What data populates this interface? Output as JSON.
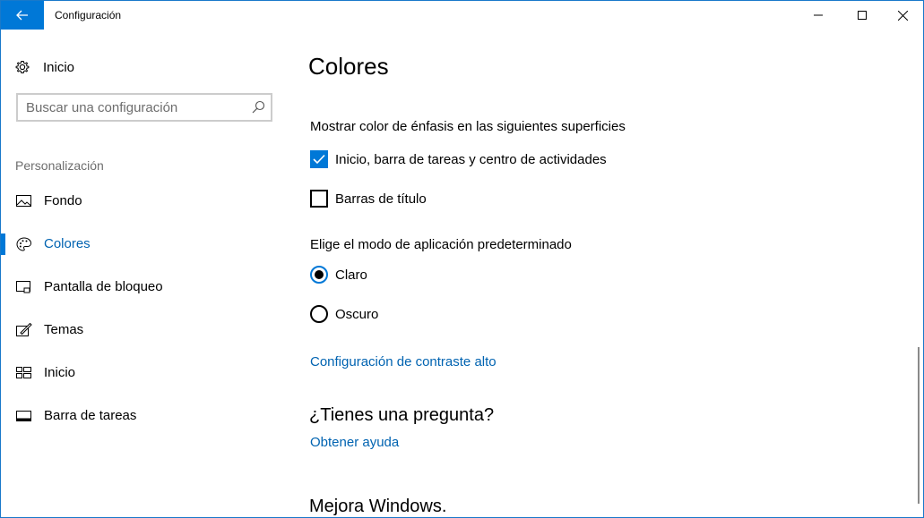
{
  "window": {
    "title": "Configuración"
  },
  "sidebar": {
    "home_label": "Inicio",
    "search_placeholder": "Buscar una configuración",
    "section_label": "Personalización",
    "items": [
      {
        "label": "Fondo",
        "icon": "picture-icon",
        "active": false
      },
      {
        "label": "Colores",
        "icon": "palette-icon",
        "active": true
      },
      {
        "label": "Pantalla de bloqueo",
        "icon": "lock-screen-icon",
        "active": false
      },
      {
        "label": "Temas",
        "icon": "themes-icon",
        "active": false
      },
      {
        "label": "Inicio",
        "icon": "start-tiles-icon",
        "active": false
      },
      {
        "label": "Barra de tareas",
        "icon": "taskbar-icon",
        "active": false
      }
    ]
  },
  "main": {
    "title": "Colores",
    "accent_heading": "Mostrar color de énfasis en las siguientes superficies",
    "checkboxes": [
      {
        "label": "Inicio, barra de tareas y centro de actividades",
        "checked": true
      },
      {
        "label": "Barras de título",
        "checked": false
      }
    ],
    "mode_heading": "Elige el modo de aplicación predeterminado",
    "radios": [
      {
        "label": "Claro",
        "selected": true
      },
      {
        "label": "Oscuro",
        "selected": false
      }
    ],
    "contrast_link": "Configuración de contraste alto",
    "question_heading": "¿Tienes una pregunta?",
    "help_link": "Obtener ayuda",
    "improve_heading": "Mejora Windows."
  },
  "colors": {
    "accent": "#0078d7",
    "link": "#0063b1",
    "secondary_text": "#6d6d6d"
  }
}
